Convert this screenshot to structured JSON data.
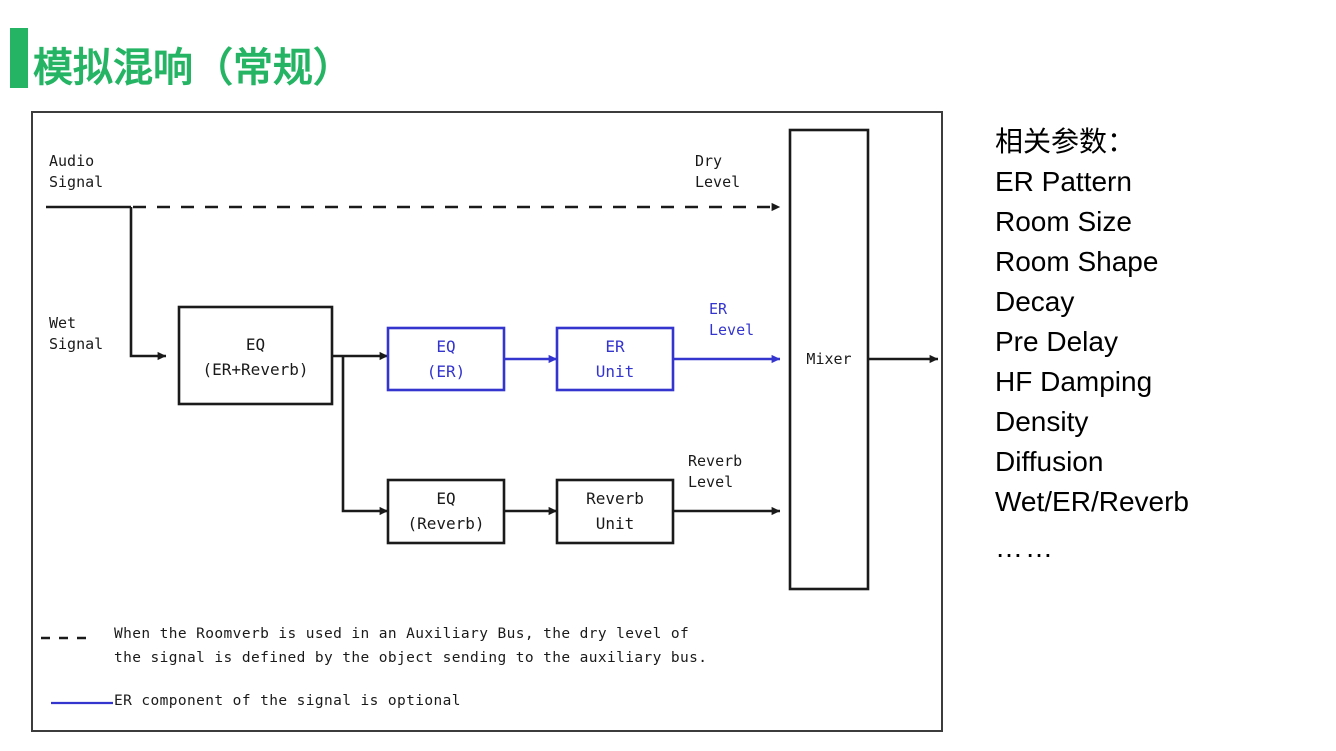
{
  "slide": {
    "title": "模拟混响（常规）",
    "accent_color": "#24b463"
  },
  "diagram": {
    "signal_colors": {
      "main": "#1a1a1a",
      "er_path": "#3434cf"
    },
    "labels": {
      "audio_signal": "Audio\nSignal",
      "wet_signal": "Wet\nSignal",
      "dry_level": "Dry\nLevel",
      "er_level": "ER\nLevel",
      "reverb_level": "Reverb\nLevel"
    },
    "blocks": {
      "eq_er_reverb": "EQ\n(ER+Reverb)",
      "eq_er": "EQ\n(ER)",
      "er_unit": "ER\nUnit",
      "eq_reverb": "EQ\n(Reverb)",
      "reverb_unit": "Reverb\nUnit",
      "mixer": "Mixer"
    },
    "legend": {
      "dashed_line_1": "When the Roomverb is used in an Auxiliary Bus, the dry level of",
      "dashed_line_2": "the signal is defined by the object sending to the auxiliary bus.",
      "solid_blue_line": "ER component of the signal is optional"
    }
  },
  "parameters": {
    "heading": "相关参数：",
    "items": [
      "ER Pattern",
      "Room Size",
      "Room Shape",
      "Decay",
      "Pre Delay",
      "HF Damping",
      "Density",
      "Diffusion",
      "Wet/ER/Reverb"
    ],
    "ellipsis": "……"
  }
}
